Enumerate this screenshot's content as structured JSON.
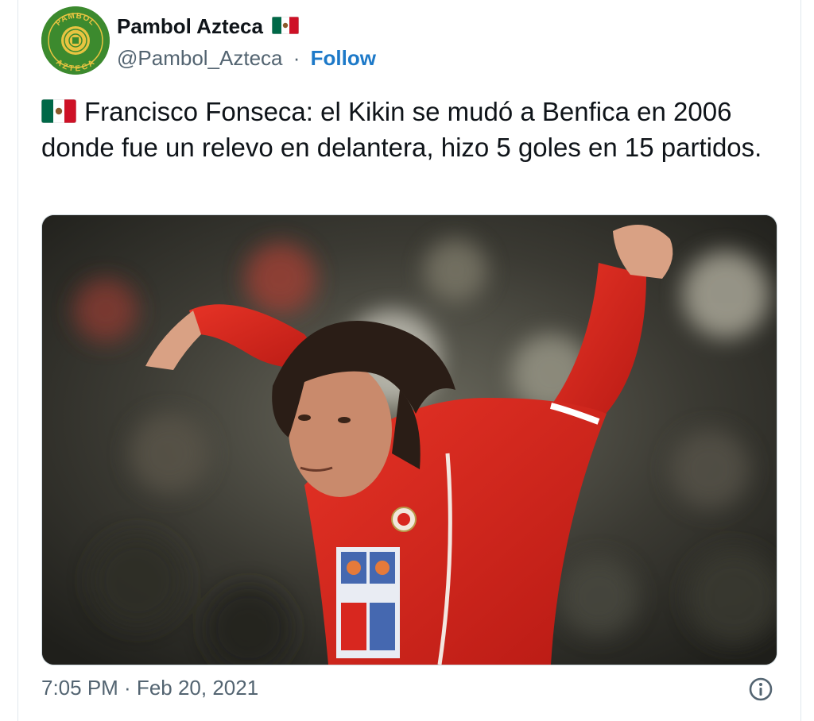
{
  "author": {
    "display_name": "Pambol Azteca",
    "handle": "@Pambol_Azteca",
    "separator": "·",
    "follow_label": "Follow",
    "avatar_icon": "pambol-azteca-logo",
    "avatar_logo_text_top": "PAMBOL",
    "avatar_logo_text_bottom": "AZTECA",
    "avatar_color": "#3c8a2e",
    "avatar_text_color": "#e8c441"
  },
  "tweet": {
    "flag_icon": "mexico-flag",
    "text": "Francisco Fonseca: el Kikin se mudó a Benfica en 2006 donde fue un relevo en delantera, hizo 5 goles en 15 partidos.",
    "media_description_icon": "photo-football-player-red-jersey",
    "jersey_color": "#d8271f"
  },
  "footer": {
    "timestamp": "7:05 PM · Feb 20, 2021",
    "info_icon": "info-icon"
  },
  "colors": {
    "follow_link": "#1d79c8",
    "secondary_text": "#536471",
    "primary_text": "#0f1419",
    "border": "#cfd9de"
  }
}
